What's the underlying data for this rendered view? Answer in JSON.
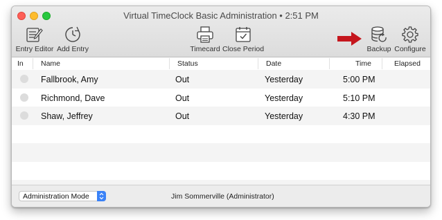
{
  "window": {
    "title": "Virtual TimeClock Basic Administration • 2:51 PM"
  },
  "toolbar": {
    "entry_editor": "Entry Editor",
    "add_entry": "Add Entry",
    "timecard": "Timecard",
    "close_period": "Close Period",
    "backup": "Backup",
    "configure": "Configure",
    "highlight_color": "#c5161d"
  },
  "table": {
    "columns": [
      "In",
      "Name",
      "Status",
      "Date",
      "Time",
      "Elapsed"
    ],
    "rows": [
      {
        "name": "Fallbrook, Amy",
        "status": "Out",
        "date": "Yesterday",
        "time": "5:00 PM",
        "elapsed": ""
      },
      {
        "name": "Richmond, Dave",
        "status": "Out",
        "date": "Yesterday",
        "time": "5:10 PM",
        "elapsed": ""
      },
      {
        "name": "Shaw, Jeffrey",
        "status": "Out",
        "date": "Yesterday",
        "time": "4:30 PM",
        "elapsed": ""
      }
    ]
  },
  "statusbar": {
    "mode_selected": "Administration Mode",
    "user": "Jim Sommerville (Administrator)"
  },
  "icons": {
    "entry_editor": "pencil-list-icon",
    "add_entry": "clock-add-icon",
    "timecard": "printer-icon",
    "close_period": "calendar-check-icon",
    "backup": "database-sync-icon",
    "configure": "gear-icon",
    "pointer": "right-arrow-icon"
  }
}
